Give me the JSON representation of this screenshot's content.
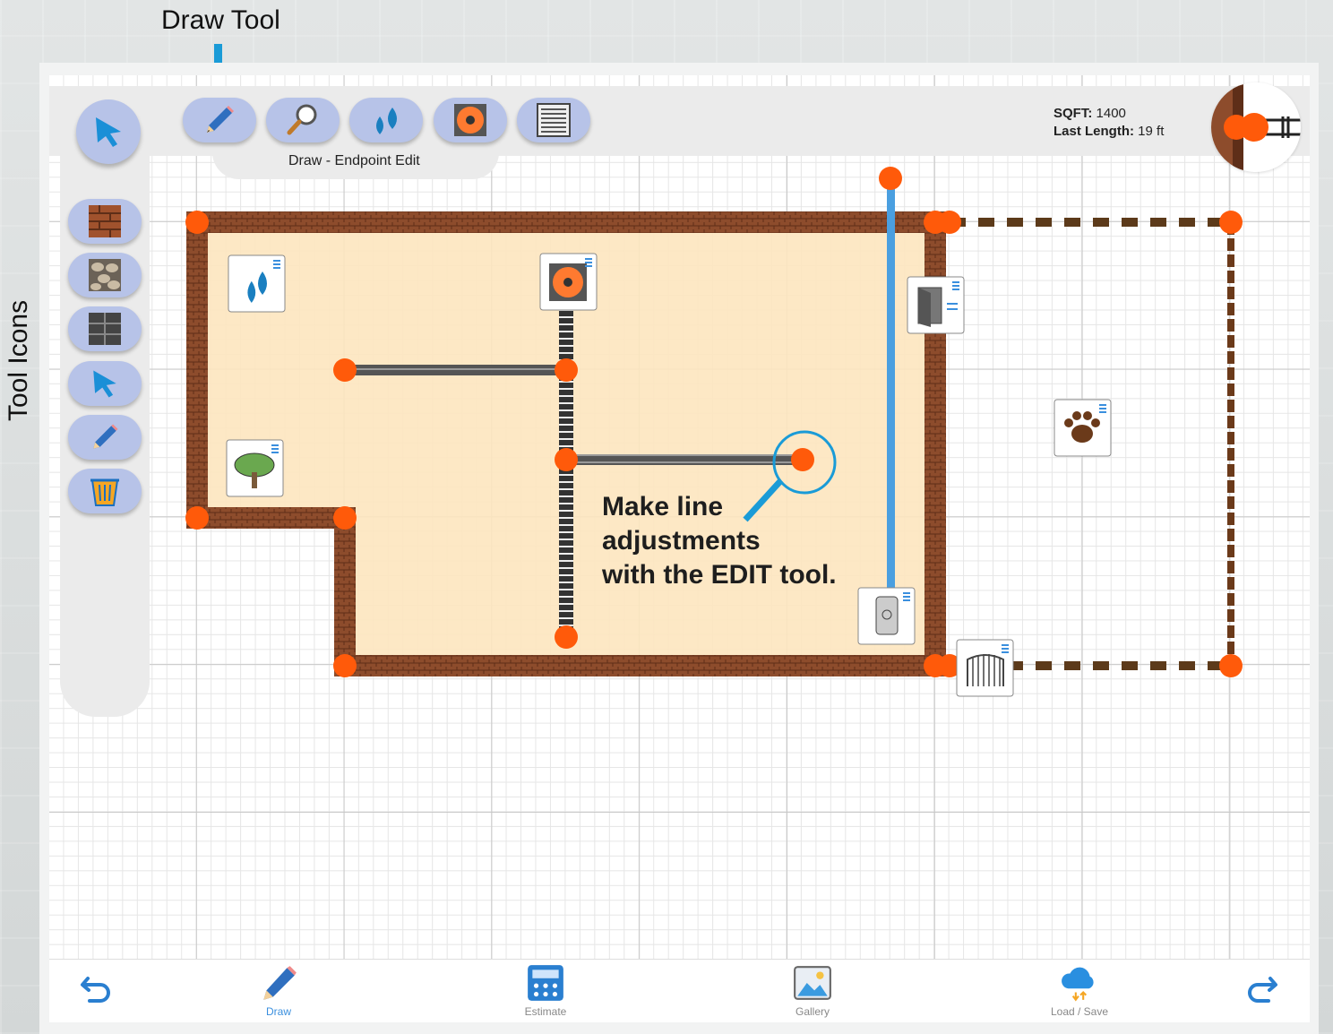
{
  "callouts": {
    "draw_tool": "Draw Tool",
    "tool_icons": "Tool Icons"
  },
  "toolbar": {
    "tools": [
      {
        "name": "pencil-icon"
      },
      {
        "name": "magnifier-icon"
      },
      {
        "name": "water-drops-icon"
      },
      {
        "name": "fan-icon"
      },
      {
        "name": "vent-icon"
      }
    ],
    "mode_label": "Draw - Endpoint Edit"
  },
  "sidebar": {
    "tools": [
      {
        "name": "select-arrow-icon"
      },
      {
        "name": "brick-wall-icon"
      },
      {
        "name": "stone-icon"
      },
      {
        "name": "tile-icon"
      },
      {
        "name": "edit-arrow-icon"
      },
      {
        "name": "pencil-icon"
      },
      {
        "name": "trash-icon"
      }
    ]
  },
  "stats": {
    "sqft_label": "SQFT:",
    "sqft_value": "1400",
    "length_label": "Last Length:",
    "length_value": "19 ft"
  },
  "annotation": {
    "line1": "Make line",
    "line2": "adjustments",
    "line3": "with the EDIT tool."
  },
  "bottom_nav": {
    "draw": "Draw",
    "estimate": "Estimate",
    "gallery": "Gallery",
    "load_save": "Load / Save"
  },
  "colors": {
    "brick": "#8a4a2a",
    "floor": "#fde6bf",
    "endpoint": "#ff5a0a",
    "button": "#b7c3e8",
    "accent": "#1a9bd7",
    "active_nav": "#3a8fde"
  }
}
